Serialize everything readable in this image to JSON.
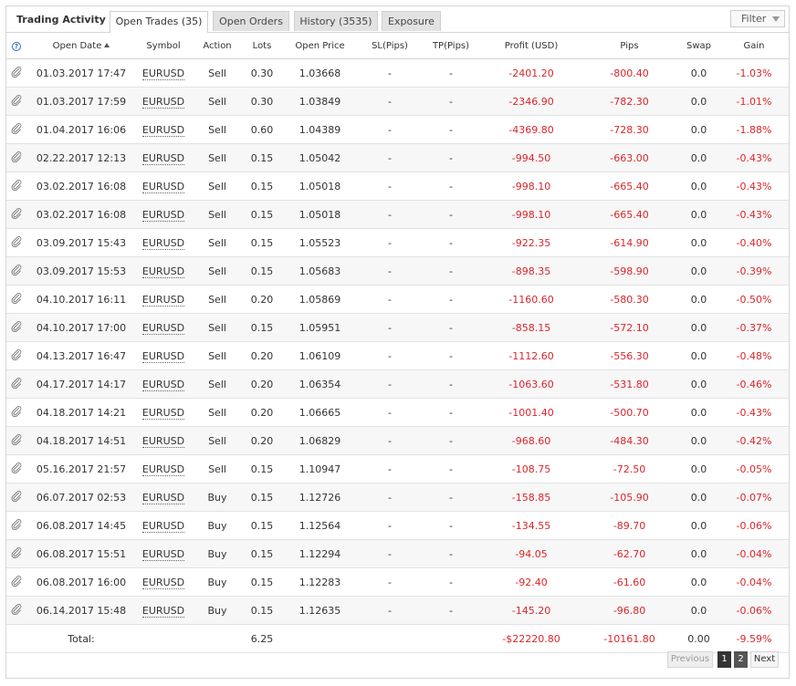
{
  "header": {
    "title": "Trading Activity",
    "tabs": [
      {
        "label": "Open Trades (35)",
        "active": true
      },
      {
        "label": "Open Orders",
        "active": false
      },
      {
        "label": "History (3535)",
        "active": false
      },
      {
        "label": "Exposure",
        "active": false
      }
    ],
    "filter_label": "Filter"
  },
  "columns": [
    "Open Date",
    "Symbol",
    "Action",
    "Lots",
    "Open Price",
    "SL(Pips)",
    "TP(Pips)",
    "Profit (USD)",
    "Pips",
    "Swap",
    "Gain"
  ],
  "help_icon": "?",
  "rows": [
    {
      "date": "01.03.2017 17:47",
      "symbol": "EURUSD",
      "action": "Sell",
      "lots": "0.30",
      "price": "1.03668",
      "sl": "-",
      "tp": "-",
      "profit": "-2401.20",
      "pips": "-800.40",
      "swap": "0.0",
      "gain": "-1.03%"
    },
    {
      "date": "01.03.2017 17:59",
      "symbol": "EURUSD",
      "action": "Sell",
      "lots": "0.30",
      "price": "1.03849",
      "sl": "-",
      "tp": "-",
      "profit": "-2346.90",
      "pips": "-782.30",
      "swap": "0.0",
      "gain": "-1.01%"
    },
    {
      "date": "01.04.2017 16:06",
      "symbol": "EURUSD",
      "action": "Sell",
      "lots": "0.60",
      "price": "1.04389",
      "sl": "-",
      "tp": "-",
      "profit": "-4369.80",
      "pips": "-728.30",
      "swap": "0.0",
      "gain": "-1.88%"
    },
    {
      "date": "02.22.2017 12:13",
      "symbol": "EURUSD",
      "action": "Sell",
      "lots": "0.15",
      "price": "1.05042",
      "sl": "-",
      "tp": "-",
      "profit": "-994.50",
      "pips": "-663.00",
      "swap": "0.0",
      "gain": "-0.43%"
    },
    {
      "date": "03.02.2017 16:08",
      "symbol": "EURUSD",
      "action": "Sell",
      "lots": "0.15",
      "price": "1.05018",
      "sl": "-",
      "tp": "-",
      "profit": "-998.10",
      "pips": "-665.40",
      "swap": "0.0",
      "gain": "-0.43%"
    },
    {
      "date": "03.02.2017 16:08",
      "symbol": "EURUSD",
      "action": "Sell",
      "lots": "0.15",
      "price": "1.05018",
      "sl": "-",
      "tp": "-",
      "profit": "-998.10",
      "pips": "-665.40",
      "swap": "0.0",
      "gain": "-0.43%"
    },
    {
      "date": "03.09.2017 15:43",
      "symbol": "EURUSD",
      "action": "Sell",
      "lots": "0.15",
      "price": "1.05523",
      "sl": "-",
      "tp": "-",
      "profit": "-922.35",
      "pips": "-614.90",
      "swap": "0.0",
      "gain": "-0.40%"
    },
    {
      "date": "03.09.2017 15:53",
      "symbol": "EURUSD",
      "action": "Sell",
      "lots": "0.15",
      "price": "1.05683",
      "sl": "-",
      "tp": "-",
      "profit": "-898.35",
      "pips": "-598.90",
      "swap": "0.0",
      "gain": "-0.39%"
    },
    {
      "date": "04.10.2017 16:11",
      "symbol": "EURUSD",
      "action": "Sell",
      "lots": "0.20",
      "price": "1.05869",
      "sl": "-",
      "tp": "-",
      "profit": "-1160.60",
      "pips": "-580.30",
      "swap": "0.0",
      "gain": "-0.50%"
    },
    {
      "date": "04.10.2017 17:00",
      "symbol": "EURUSD",
      "action": "Sell",
      "lots": "0.15",
      "price": "1.05951",
      "sl": "-",
      "tp": "-",
      "profit": "-858.15",
      "pips": "-572.10",
      "swap": "0.0",
      "gain": "-0.37%"
    },
    {
      "date": "04.13.2017 16:47",
      "symbol": "EURUSD",
      "action": "Sell",
      "lots": "0.20",
      "price": "1.06109",
      "sl": "-",
      "tp": "-",
      "profit": "-1112.60",
      "pips": "-556.30",
      "swap": "0.0",
      "gain": "-0.48%"
    },
    {
      "date": "04.17.2017 14:17",
      "symbol": "EURUSD",
      "action": "Sell",
      "lots": "0.20",
      "price": "1.06354",
      "sl": "-",
      "tp": "-",
      "profit": "-1063.60",
      "pips": "-531.80",
      "swap": "0.0",
      "gain": "-0.46%"
    },
    {
      "date": "04.18.2017 14:21",
      "symbol": "EURUSD",
      "action": "Sell",
      "lots": "0.20",
      "price": "1.06665",
      "sl": "-",
      "tp": "-",
      "profit": "-1001.40",
      "pips": "-500.70",
      "swap": "0.0",
      "gain": "-0.43%"
    },
    {
      "date": "04.18.2017 14:51",
      "symbol": "EURUSD",
      "action": "Sell",
      "lots": "0.20",
      "price": "1.06829",
      "sl": "-",
      "tp": "-",
      "profit": "-968.60",
      "pips": "-484.30",
      "swap": "0.0",
      "gain": "-0.42%"
    },
    {
      "date": "05.16.2017 21:57",
      "symbol": "EURUSD",
      "action": "Sell",
      "lots": "0.15",
      "price": "1.10947",
      "sl": "-",
      "tp": "-",
      "profit": "-108.75",
      "pips": "-72.50",
      "swap": "0.0",
      "gain": "-0.05%"
    },
    {
      "date": "06.07.2017 02:53",
      "symbol": "EURUSD",
      "action": "Buy",
      "lots": "0.15",
      "price": "1.12726",
      "sl": "-",
      "tp": "-",
      "profit": "-158.85",
      "pips": "-105.90",
      "swap": "0.0",
      "gain": "-0.07%"
    },
    {
      "date": "06.08.2017 14:45",
      "symbol": "EURUSD",
      "action": "Buy",
      "lots": "0.15",
      "price": "1.12564",
      "sl": "-",
      "tp": "-",
      "profit": "-134.55",
      "pips": "-89.70",
      "swap": "0.0",
      "gain": "-0.06%"
    },
    {
      "date": "06.08.2017 15:51",
      "symbol": "EURUSD",
      "action": "Buy",
      "lots": "0.15",
      "price": "1.12294",
      "sl": "-",
      "tp": "-",
      "profit": "-94.05",
      "pips": "-62.70",
      "swap": "0.0",
      "gain": "-0.04%"
    },
    {
      "date": "06.08.2017 16:00",
      "symbol": "EURUSD",
      "action": "Buy",
      "lots": "0.15",
      "price": "1.12283",
      "sl": "-",
      "tp": "-",
      "profit": "-92.40",
      "pips": "-61.60",
      "swap": "0.0",
      "gain": "-0.04%"
    },
    {
      "date": "06.14.2017 15:48",
      "symbol": "EURUSD",
      "action": "Buy",
      "lots": "0.15",
      "price": "1.12635",
      "sl": "-",
      "tp": "-",
      "profit": "-145.20",
      "pips": "-96.80",
      "swap": "0.0",
      "gain": "-0.06%"
    }
  ],
  "totals": {
    "label": "Total:",
    "lots": "6.25",
    "profit": "-$22220.80",
    "pips": "-10161.80",
    "swap": "0.00",
    "gain": "-9.59%"
  },
  "pagination": {
    "previous": "Previous",
    "pages": [
      "1",
      "2"
    ],
    "next": "Next"
  },
  "colors": {
    "negative": "#d9262c",
    "tab_bg": "#e2e2e2",
    "help_icon": "#2b6cc4"
  }
}
